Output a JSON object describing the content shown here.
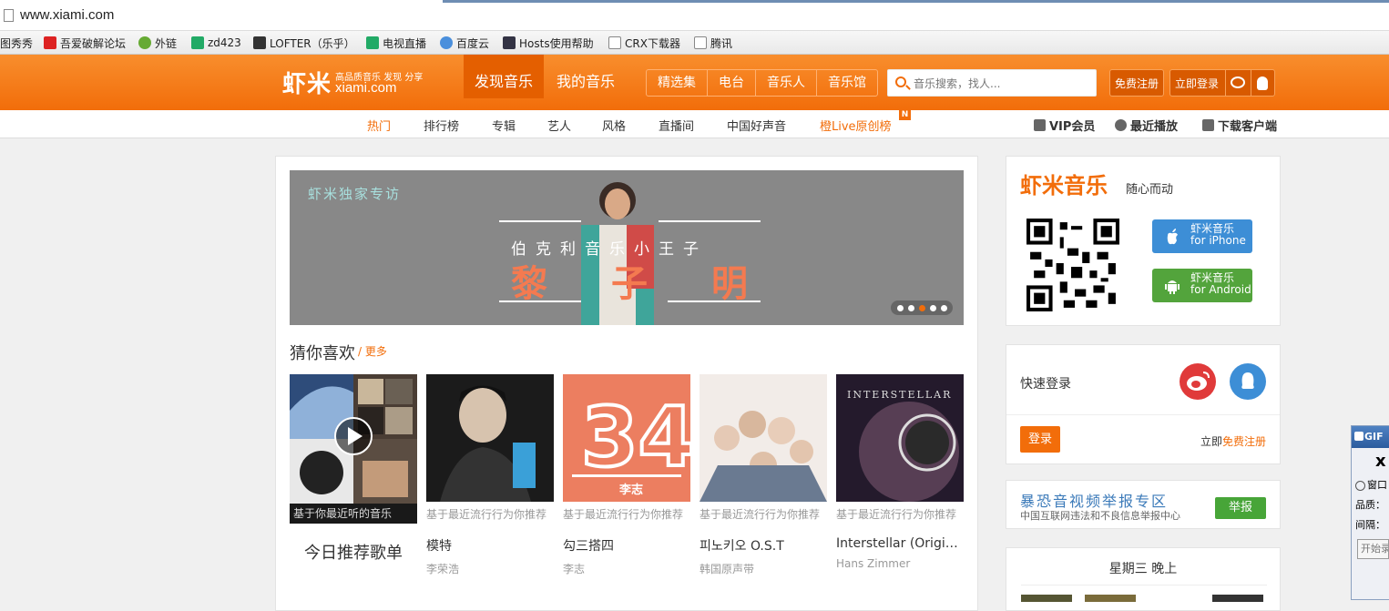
{
  "browser": {
    "url": "www.xiami.com",
    "bookmarks": [
      {
        "label": "图秀秀",
        "color": "#ffffff"
      },
      {
        "label": "吾爱破解论坛",
        "color": "#d22"
      },
      {
        "label": "外链",
        "color": "#6a3"
      },
      {
        "label": "zd423",
        "color": "#2a6"
      },
      {
        "label": "LOFTER（乐乎）",
        "color": "#333"
      },
      {
        "label": "电视直播",
        "color": "#2a6"
      },
      {
        "label": "百度云",
        "color": "#4a8fdc"
      },
      {
        "label": "Hosts使用帮助",
        "color": "#334"
      },
      {
        "label": "CRX下载器",
        "color": "#eee"
      },
      {
        "label": "腾讯",
        "color": "#eee"
      }
    ]
  },
  "header": {
    "logo_cn": "虾米",
    "logo_tag": "高品质音乐 发现 分享",
    "logo_domain": "xiami.com",
    "main_nav": [
      "发现音乐",
      "我的音乐"
    ],
    "sub_nav": [
      "精选集",
      "电台",
      "音乐人",
      "音乐馆"
    ],
    "search_placeholder": "音乐搜索，找人...",
    "register": "免费注册",
    "login": "立即登录"
  },
  "nav2": {
    "items": [
      "热门",
      "排行榜",
      "专辑",
      "艺人",
      "风格",
      "直播间",
      "中国好声音"
    ],
    "live": "橙Live原创榜",
    "badge": "N",
    "right": [
      "VIP会员",
      "最近播放",
      "下载客户端"
    ]
  },
  "banner": {
    "tag": "虾米独家专访",
    "subtitle": "伯克利音乐小王子",
    "name": "黎子明",
    "slides": 5,
    "active_slide": 3
  },
  "guess": {
    "title": "猜你喜欢",
    "more": "/ 更多",
    "today": {
      "reason": "基于你最近听的音乐",
      "title": "今日推荐歌单"
    },
    "cards": [
      {
        "reason": "基于最近流行行为你推荐",
        "title": "模特",
        "artist": "李荣浩"
      },
      {
        "reason": "基于最近流行行为你推荐",
        "title": "勾三搭四",
        "artist": "李志"
      },
      {
        "reason": "基于最近流行行为你推荐",
        "title": "피노키오 O.S.T",
        "artist": "韩国原声带"
      },
      {
        "reason": "基于最近流行行为你推荐",
        "title": "Interstellar (Original...",
        "artist": "Hans Zimmer"
      }
    ]
  },
  "app": {
    "logo": "虾米音乐",
    "slogan": "随心而动",
    "iphone": {
      "line1": "虾米音乐",
      "line2": "for iPhone"
    },
    "android": {
      "line1": "虾米音乐",
      "line2": "for Android"
    }
  },
  "quick_login": {
    "label": "快速登录",
    "login": "登录",
    "register_prefix": "立即",
    "register_link": "免费注册"
  },
  "report": {
    "title": "暴恐音视频举报专区",
    "subtitle": "中国互联网违法和不良信息举报中心",
    "button": "举报"
  },
  "schedule": {
    "title": "星期三 晚上"
  },
  "gif_widget": {
    "title": "GIF",
    "brand": "x",
    "option": "窗口",
    "quality": "品质：",
    "interval": "间隔：",
    "start": "开始录"
  },
  "colors": {
    "accent": "#f26d0a",
    "link_blue": "#3b7ab9",
    "green": "#47a538"
  }
}
